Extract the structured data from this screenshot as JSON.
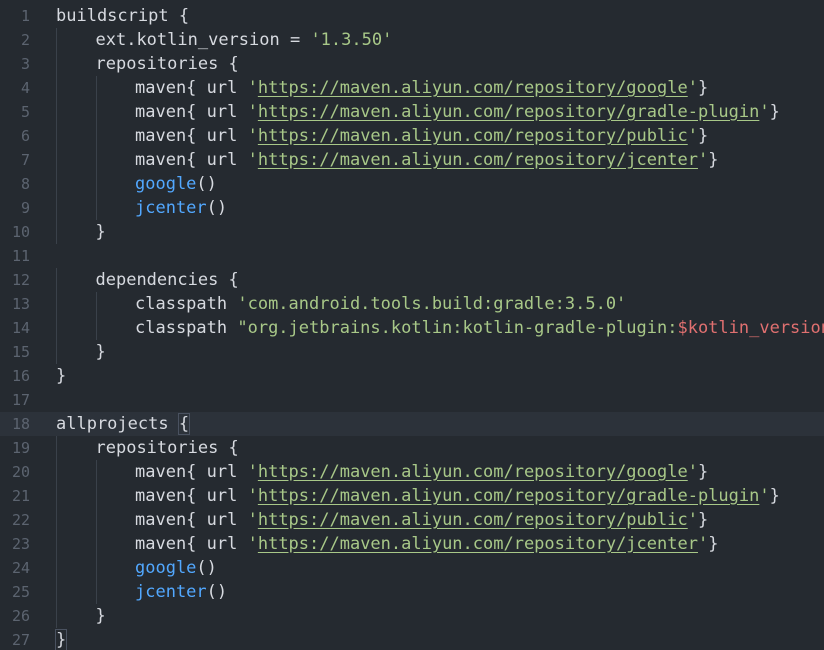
{
  "colors": {
    "background": "#252a30",
    "active_line": "#2c323a",
    "line_number": "#5c6470",
    "plain_text": "#d7dae0",
    "function": "#52a8ff",
    "string": "#a8c888",
    "variable": "#e07070"
  },
  "active_line_number": "18",
  "lines": [
    {
      "num": "1",
      "indent": 0,
      "tokens": [
        {
          "t": "buildscript {",
          "k": "plain"
        }
      ]
    },
    {
      "num": "2",
      "indent": 1,
      "tokens": [
        {
          "t": "ext.kotlin_version = ",
          "k": "plain"
        },
        {
          "t": "'1.3.50'",
          "k": "str"
        }
      ]
    },
    {
      "num": "3",
      "indent": 1,
      "tokens": [
        {
          "t": "repositories {",
          "k": "plain"
        }
      ]
    },
    {
      "num": "4",
      "indent": 2,
      "tokens": [
        {
          "t": "maven{ url ",
          "k": "plain"
        },
        {
          "t": "'",
          "k": "str"
        },
        {
          "t": "https://maven.aliyun.com/repository/google",
          "k": "url"
        },
        {
          "t": "'",
          "k": "str"
        },
        {
          "t": "}",
          "k": "plain"
        }
      ]
    },
    {
      "num": "5",
      "indent": 2,
      "tokens": [
        {
          "t": "maven{ url ",
          "k": "plain"
        },
        {
          "t": "'",
          "k": "str"
        },
        {
          "t": "https://maven.aliyun.com/repository/gradle-plugin",
          "k": "url"
        },
        {
          "t": "'",
          "k": "str"
        },
        {
          "t": "}",
          "k": "plain"
        }
      ]
    },
    {
      "num": "6",
      "indent": 2,
      "tokens": [
        {
          "t": "maven{ url ",
          "k": "plain"
        },
        {
          "t": "'",
          "k": "str"
        },
        {
          "t": "https://maven.aliyun.com/repository/public",
          "k": "url"
        },
        {
          "t": "'",
          "k": "str"
        },
        {
          "t": "}",
          "k": "plain"
        }
      ]
    },
    {
      "num": "7",
      "indent": 2,
      "tokens": [
        {
          "t": "maven{ url ",
          "k": "plain"
        },
        {
          "t": "'",
          "k": "str"
        },
        {
          "t": "https://maven.aliyun.com/repository/jcenter",
          "k": "url"
        },
        {
          "t": "'",
          "k": "str"
        },
        {
          "t": "}",
          "k": "plain"
        }
      ]
    },
    {
      "num": "8",
      "indent": 2,
      "tokens": [
        {
          "t": "google",
          "k": "fn"
        },
        {
          "t": "()",
          "k": "plain"
        }
      ]
    },
    {
      "num": "9",
      "indent": 2,
      "tokens": [
        {
          "t": "jcenter",
          "k": "fn"
        },
        {
          "t": "()",
          "k": "plain"
        }
      ]
    },
    {
      "num": "10",
      "indent": 1,
      "tokens": [
        {
          "t": "}",
          "k": "plain"
        }
      ]
    },
    {
      "num": "11",
      "indent": 0,
      "tokens": []
    },
    {
      "num": "12",
      "indent": 1,
      "tokens": [
        {
          "t": "dependencies {",
          "k": "plain"
        }
      ]
    },
    {
      "num": "13",
      "indent": 2,
      "tokens": [
        {
          "t": "classpath ",
          "k": "plain"
        },
        {
          "t": "'com.android.tools.build:gradle:3.5.0'",
          "k": "str"
        }
      ]
    },
    {
      "num": "14",
      "indent": 2,
      "tokens": [
        {
          "t": "classpath ",
          "k": "plain"
        },
        {
          "t": "\"org.jetbrains.kotlin:kotlin-gradle-plugin:",
          "k": "str"
        },
        {
          "t": "$kotlin_version",
          "k": "var"
        },
        {
          "t": "\"",
          "k": "str"
        }
      ]
    },
    {
      "num": "15",
      "indent": 1,
      "tokens": [
        {
          "t": "}",
          "k": "plain"
        }
      ]
    },
    {
      "num": "16",
      "indent": 0,
      "tokens": [
        {
          "t": "}",
          "k": "plain"
        }
      ]
    },
    {
      "num": "17",
      "indent": 0,
      "tokens": []
    },
    {
      "num": "18",
      "indent": 0,
      "tokens": [
        {
          "t": "allprojects ",
          "k": "plain"
        },
        {
          "t": "{",
          "k": "bracket"
        }
      ]
    },
    {
      "num": "19",
      "indent": 1,
      "tokens": [
        {
          "t": "repositories {",
          "k": "plain"
        }
      ]
    },
    {
      "num": "20",
      "indent": 2,
      "tokens": [
        {
          "t": "maven{ url ",
          "k": "plain"
        },
        {
          "t": "'",
          "k": "str"
        },
        {
          "t": "https://maven.aliyun.com/repository/google",
          "k": "url"
        },
        {
          "t": "'",
          "k": "str"
        },
        {
          "t": "}",
          "k": "plain"
        }
      ]
    },
    {
      "num": "21",
      "indent": 2,
      "tokens": [
        {
          "t": "maven{ url ",
          "k": "plain"
        },
        {
          "t": "'",
          "k": "str"
        },
        {
          "t": "https://maven.aliyun.com/repository/gradle-plugin",
          "k": "url"
        },
        {
          "t": "'",
          "k": "str"
        },
        {
          "t": "}",
          "k": "plain"
        }
      ]
    },
    {
      "num": "22",
      "indent": 2,
      "tokens": [
        {
          "t": "maven{ url ",
          "k": "plain"
        },
        {
          "t": "'",
          "k": "str"
        },
        {
          "t": "https://maven.aliyun.com/repository/public",
          "k": "url"
        },
        {
          "t": "'",
          "k": "str"
        },
        {
          "t": "}",
          "k": "plain"
        }
      ]
    },
    {
      "num": "23",
      "indent": 2,
      "tokens": [
        {
          "t": "maven{ url ",
          "k": "plain"
        },
        {
          "t": "'",
          "k": "str"
        },
        {
          "t": "https://maven.aliyun.com/repository/jcenter",
          "k": "url"
        },
        {
          "t": "'",
          "k": "str"
        },
        {
          "t": "}",
          "k": "plain"
        }
      ]
    },
    {
      "num": "24",
      "indent": 2,
      "tokens": [
        {
          "t": "google",
          "k": "fn"
        },
        {
          "t": "()",
          "k": "plain"
        }
      ]
    },
    {
      "num": "25",
      "indent": 2,
      "tokens": [
        {
          "t": "jcenter",
          "k": "fn"
        },
        {
          "t": "()",
          "k": "plain"
        }
      ]
    },
    {
      "num": "26",
      "indent": 1,
      "tokens": [
        {
          "t": "}",
          "k": "plain"
        }
      ]
    },
    {
      "num": "27",
      "indent": 0,
      "tokens": [
        {
          "t": "}",
          "k": "bracket"
        }
      ]
    }
  ]
}
